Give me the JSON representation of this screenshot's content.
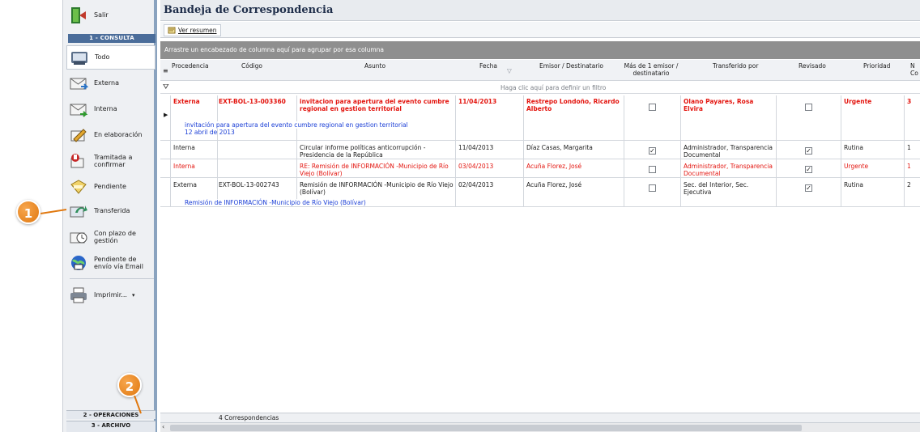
{
  "sidebar": {
    "exit_label": "Salir",
    "consulta_header": "1 - CONSULTA",
    "items": [
      {
        "label": "Todo",
        "icon": "inbox-all-icon"
      },
      {
        "label": "Externa",
        "icon": "envelope-external-icon"
      },
      {
        "label": "Interna",
        "icon": "envelope-internal-icon"
      },
      {
        "label": "En elaboración",
        "icon": "pencil-edit-icon"
      },
      {
        "label": "Tramitada a confirmar",
        "icon": "stamp-confirm-icon"
      },
      {
        "label": "Pendiente",
        "icon": "pending-folder-icon"
      },
      {
        "label": "Transferida",
        "icon": "transfer-arrow-icon"
      },
      {
        "label": "Con plazo de gestión",
        "icon": "clock-deadline-icon"
      },
      {
        "label": "Pendiente de envío vía Email",
        "icon": "email-send-icon"
      }
    ],
    "print_label": "Imprimir...",
    "operaciones_label": "2 - OPERACIONES",
    "archivo_label": "3 - ARCHIVO"
  },
  "main": {
    "title": "Bandeja de Correspondencia",
    "summary_button": "Ver resumen",
    "group_hint": "Arrastre un encabezado de columna aquí para agrupar por esa columna",
    "filter_hint": "Haga clic aquí para definir un filtro",
    "columns": {
      "procedencia": "Procedencia",
      "codigo": "Código",
      "asunto": "Asunto",
      "fecha": "Fecha",
      "emisor": "Emisor / Destinatario",
      "multi": "Más de 1 emisor / destinatario",
      "transferido": "Transferido por",
      "revisado": "Revisado",
      "prioridad": "Prioridad",
      "extra": "N Co"
    },
    "rows": [
      {
        "procedencia": "Externa",
        "codigo": "EXT-BOL-13-003360",
        "asunto": "invitacion para apertura del evento cumbre regional en gestion territorial",
        "fecha": "11/04/2013",
        "emisor": "Restrepo Londoño, Ricardo Alberto",
        "multi": false,
        "transferido": "Olano Payares, Rosa Elvira",
        "revisado": false,
        "prioridad": "Urgente",
        "extra": "3",
        "preview_line1": "invitación para apertura del evento cumbre regional en gestion territorial",
        "preview_line2": "12 abril de 2013"
      },
      {
        "procedencia": "Interna",
        "codigo": "",
        "asunto": "Circular informe políticas anticorrupción - Presidencia de la República",
        "fecha": "11/04/2013",
        "emisor": "Díaz Casas, Margarita",
        "multi": true,
        "transferido": "Administrador, Transparencia Documental",
        "revisado": true,
        "prioridad": "Rutina",
        "extra": "1"
      },
      {
        "procedencia": "Interna",
        "codigo": "",
        "asunto": "RE: Remisión de INFORMACIÓN -Municipio de Río Viejo (Bolívar)",
        "fecha": "03/04/2013",
        "emisor": "Acuña Florez, José",
        "multi": false,
        "transferido": "Administrador, Transparencia Documental",
        "revisado": true,
        "prioridad": "Urgente",
        "extra": "1"
      },
      {
        "procedencia": "Externa",
        "codigo": "EXT-BOL-13-002743",
        "asunto": "Remisión de INFORMACIÓN -Municipio de Río Viejo (Bolívar)",
        "fecha": "02/04/2013",
        "emisor": "Acuña Florez, José",
        "multi": false,
        "transferido": "Sec. del Interior, Sec. Ejecutiva",
        "revisado": true,
        "prioridad": "Rutina",
        "extra": "2",
        "preview_line1": "Remisión de INFORMACIÓN -Municipio de Río Viejo (Bolívar)"
      }
    ],
    "footer_count": "4 Correspondencias"
  },
  "callouts": [
    "1",
    "2"
  ],
  "colors": {
    "urgent": "#e3150f",
    "preview": "#1a3ed6",
    "header_blue": "#4b6d9a",
    "callout_orange": "#e0780f"
  }
}
